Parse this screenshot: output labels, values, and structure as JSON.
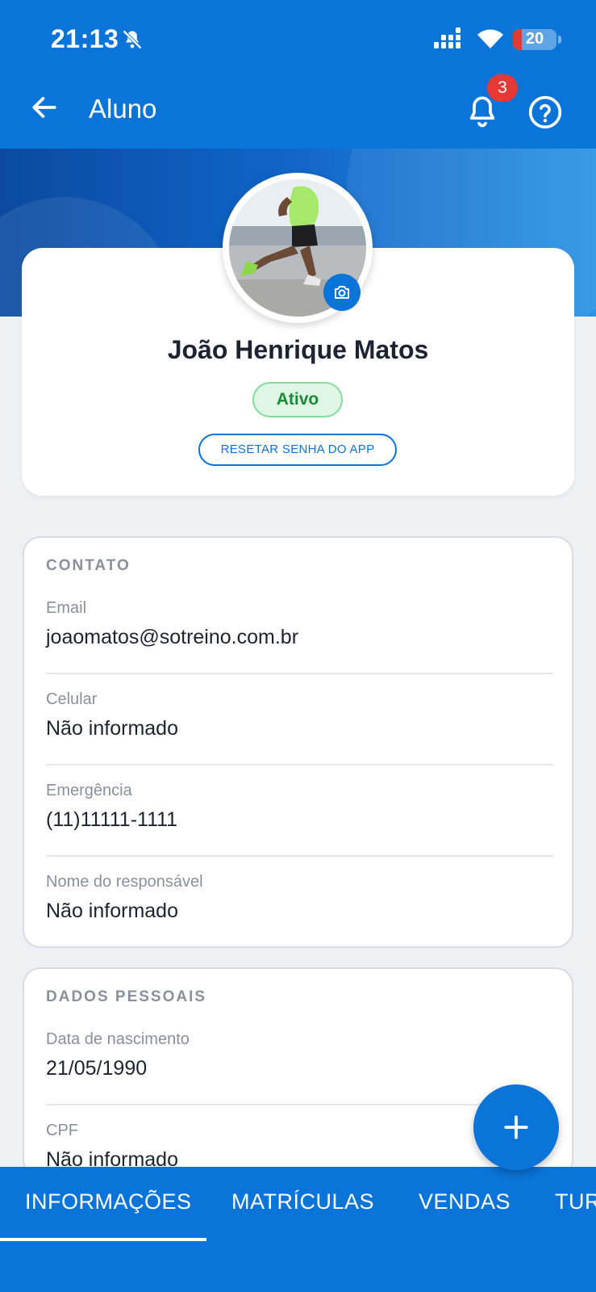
{
  "status_bar": {
    "time": "21:13",
    "battery": "20",
    "icons": [
      "bell-off-icon",
      "signal-icon",
      "wifi-icon",
      "battery-icon"
    ]
  },
  "app_bar": {
    "title": "Aluno",
    "notification_count": "3",
    "icons": [
      "back-arrow-icon",
      "bell-icon",
      "help-icon"
    ]
  },
  "profile": {
    "name": "João Henrique Matos",
    "status": "Ativo",
    "reset_button": "RESETAR SENHA DO APP"
  },
  "contato": {
    "title": "CONTATO",
    "fields": [
      {
        "label": "Email",
        "value": "joaomatos@sotreino.com.br"
      },
      {
        "label": "Celular",
        "value": "Não informado"
      },
      {
        "label": "Emergência",
        "value": "(11)11111-1111"
      },
      {
        "label": "Nome do responsável",
        "value": "Não informado"
      }
    ]
  },
  "dados_pessoais": {
    "title": "DADOS PESSOAIS",
    "fields": [
      {
        "label": "Data de nascimento",
        "value": "21/05/1990"
      },
      {
        "label": "CPF",
        "value": "Não informado"
      }
    ]
  },
  "tabs": [
    {
      "label": "INFORMAÇÕES",
      "active": true
    },
    {
      "label": "MATRÍCULAS",
      "active": false
    },
    {
      "label": "VENDAS",
      "active": false
    },
    {
      "label": "TURMAS",
      "active": false
    }
  ],
  "colors": {
    "primary": "#0a74d8",
    "status_active_bg": "#dff6e4",
    "status_active_text": "#1a8a3a",
    "badge": "#e53935"
  }
}
